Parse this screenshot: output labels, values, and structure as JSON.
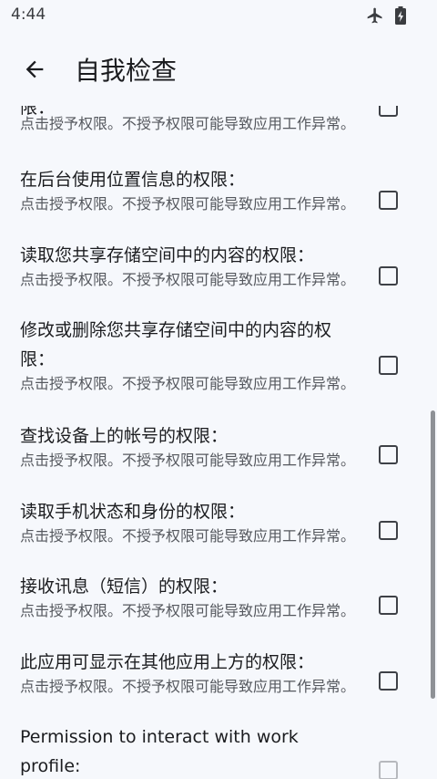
{
  "status_bar": {
    "time": "4:44",
    "icons": [
      "airplane-mode-icon",
      "battery-charging-icon"
    ]
  },
  "app_bar": {
    "back_icon": "arrow-left-icon",
    "title": "自我检查"
  },
  "permissions": [
    {
      "title": "限：",
      "subtitle": "点击授予权限。不授予权限可能导致应用工作异常。",
      "checked": false
    },
    {
      "title": "在后台使用位置信息的权限：",
      "subtitle": "点击授予权限。不授予权限可能导致应用工作异常。",
      "checked": false
    },
    {
      "title": "读取您共享存储空间中的内容的权限：",
      "subtitle": "点击授予权限。不授予权限可能导致应用工作异常。",
      "checked": false
    },
    {
      "title": "修改或删除您共享存储空间中的内容的权限：",
      "subtitle": "点击授予权限。不授予权限可能导致应用工作异常。",
      "checked": false
    },
    {
      "title": "查找设备上的帐号的权限：",
      "subtitle": "点击授予权限。不授予权限可能导致应用工作异常。",
      "checked": false
    },
    {
      "title": "读取手机状态和身份的权限：",
      "subtitle": "点击授予权限。不授予权限可能导致应用工作异常。",
      "checked": false
    },
    {
      "title": "接收讯息（短信）的权限：",
      "subtitle": "点击授予权限。不授予权限可能导致应用工作异常。",
      "checked": false
    },
    {
      "title": "此应用可显示在其他应用上方的权限：",
      "subtitle": "点击授予权限。不授予权限可能导致应用工作异常。",
      "checked": false
    },
    {
      "title": "Permission to interact with work profile:",
      "subtitle": "",
      "checked": false
    }
  ]
}
